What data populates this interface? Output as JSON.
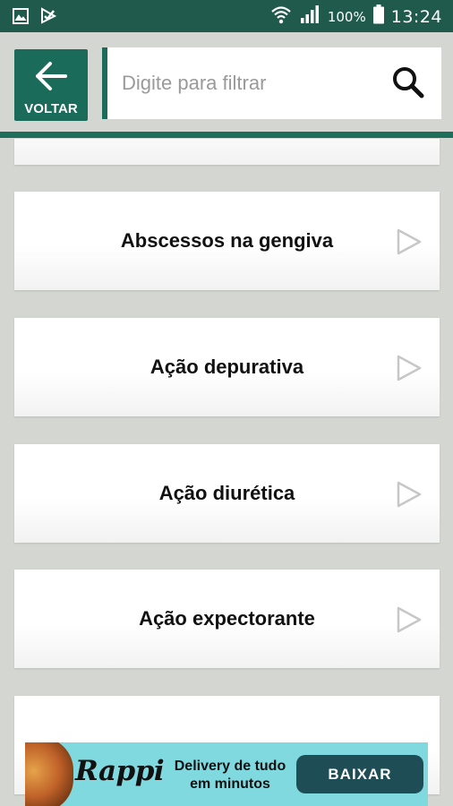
{
  "status_bar": {
    "battery": "100%",
    "time": "13:24"
  },
  "header": {
    "back_label": "VOLTAR",
    "search_placeholder": "Digite para filtrar",
    "accent_color": "#1b6b5a"
  },
  "list": {
    "items": [
      {
        "label": ""
      },
      {
        "label": "Abscessos na gengiva"
      },
      {
        "label": "Ação depurativa"
      },
      {
        "label": "Ação diurética"
      },
      {
        "label": "Ação expectorante"
      },
      {
        "label": ""
      }
    ]
  },
  "ad": {
    "brand": "Rappi",
    "line1": "Delivery de tudo",
    "line2": "em minutos",
    "button": "BAIXAR",
    "background": "#7fd9df"
  }
}
